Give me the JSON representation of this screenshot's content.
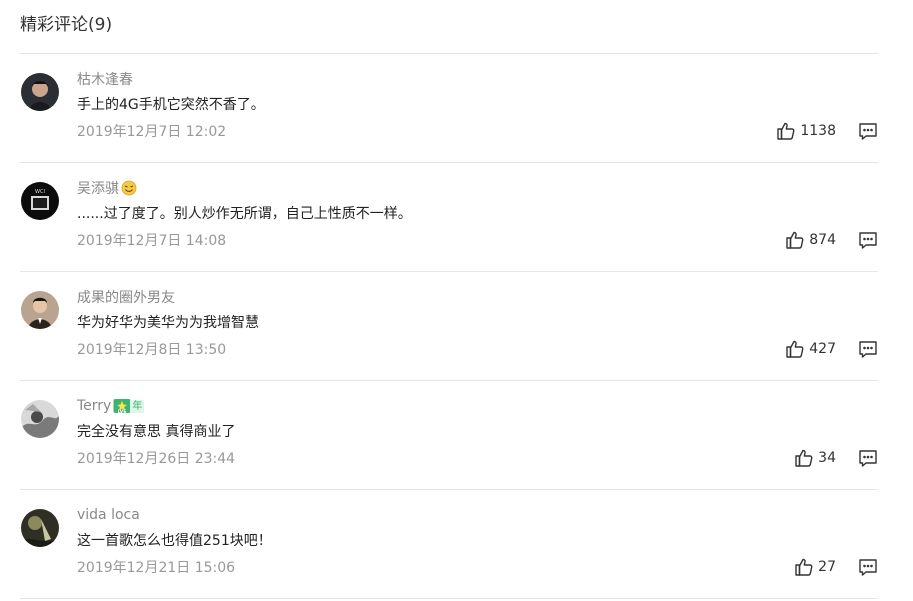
{
  "section": {
    "title": "精彩评论(9)"
  },
  "comments": [
    {
      "username": "枯木逢春",
      "text": "手上的4G手机它突然不香了。",
      "time": "2019年12月7日 12:02",
      "likes": "1138",
      "avatar_color": "#3a3a3a"
    },
    {
      "username": "吴添骐",
      "badge": "emoji-face",
      "text": "......过了度了。别人炒作无所谓，自己上性质不一样。",
      "time": "2019年12月7日 14:08",
      "likes": "874",
      "avatar_color": "#111111"
    },
    {
      "username": "成果的圈外男友",
      "text": "华为好华为美华为为我增智慧",
      "time": "2019年12月8日 13:50",
      "likes": "427",
      "avatar_color": "#5a4a3e"
    },
    {
      "username": "Terry",
      "badge": "vip-level-badge",
      "badge_text": "年",
      "text": "完全没有意思 真得商业了",
      "time": "2019年12月26日 23:44",
      "likes": "34",
      "avatar_color": "#9a9a9a"
    },
    {
      "username": "vida loca",
      "text": "这一首歌怎么也得值251块吧！",
      "time": "2019年12月21日 15:06",
      "likes": "27",
      "avatar_color": "#4b4b3c"
    }
  ],
  "colors": {
    "divider": "#e6e6e6",
    "username": "#888888",
    "time": "#999999",
    "text": "#222222",
    "badge_green": "#3cb371"
  },
  "icons": {
    "like": "thumbs-up-icon",
    "reply": "comment-icon"
  }
}
